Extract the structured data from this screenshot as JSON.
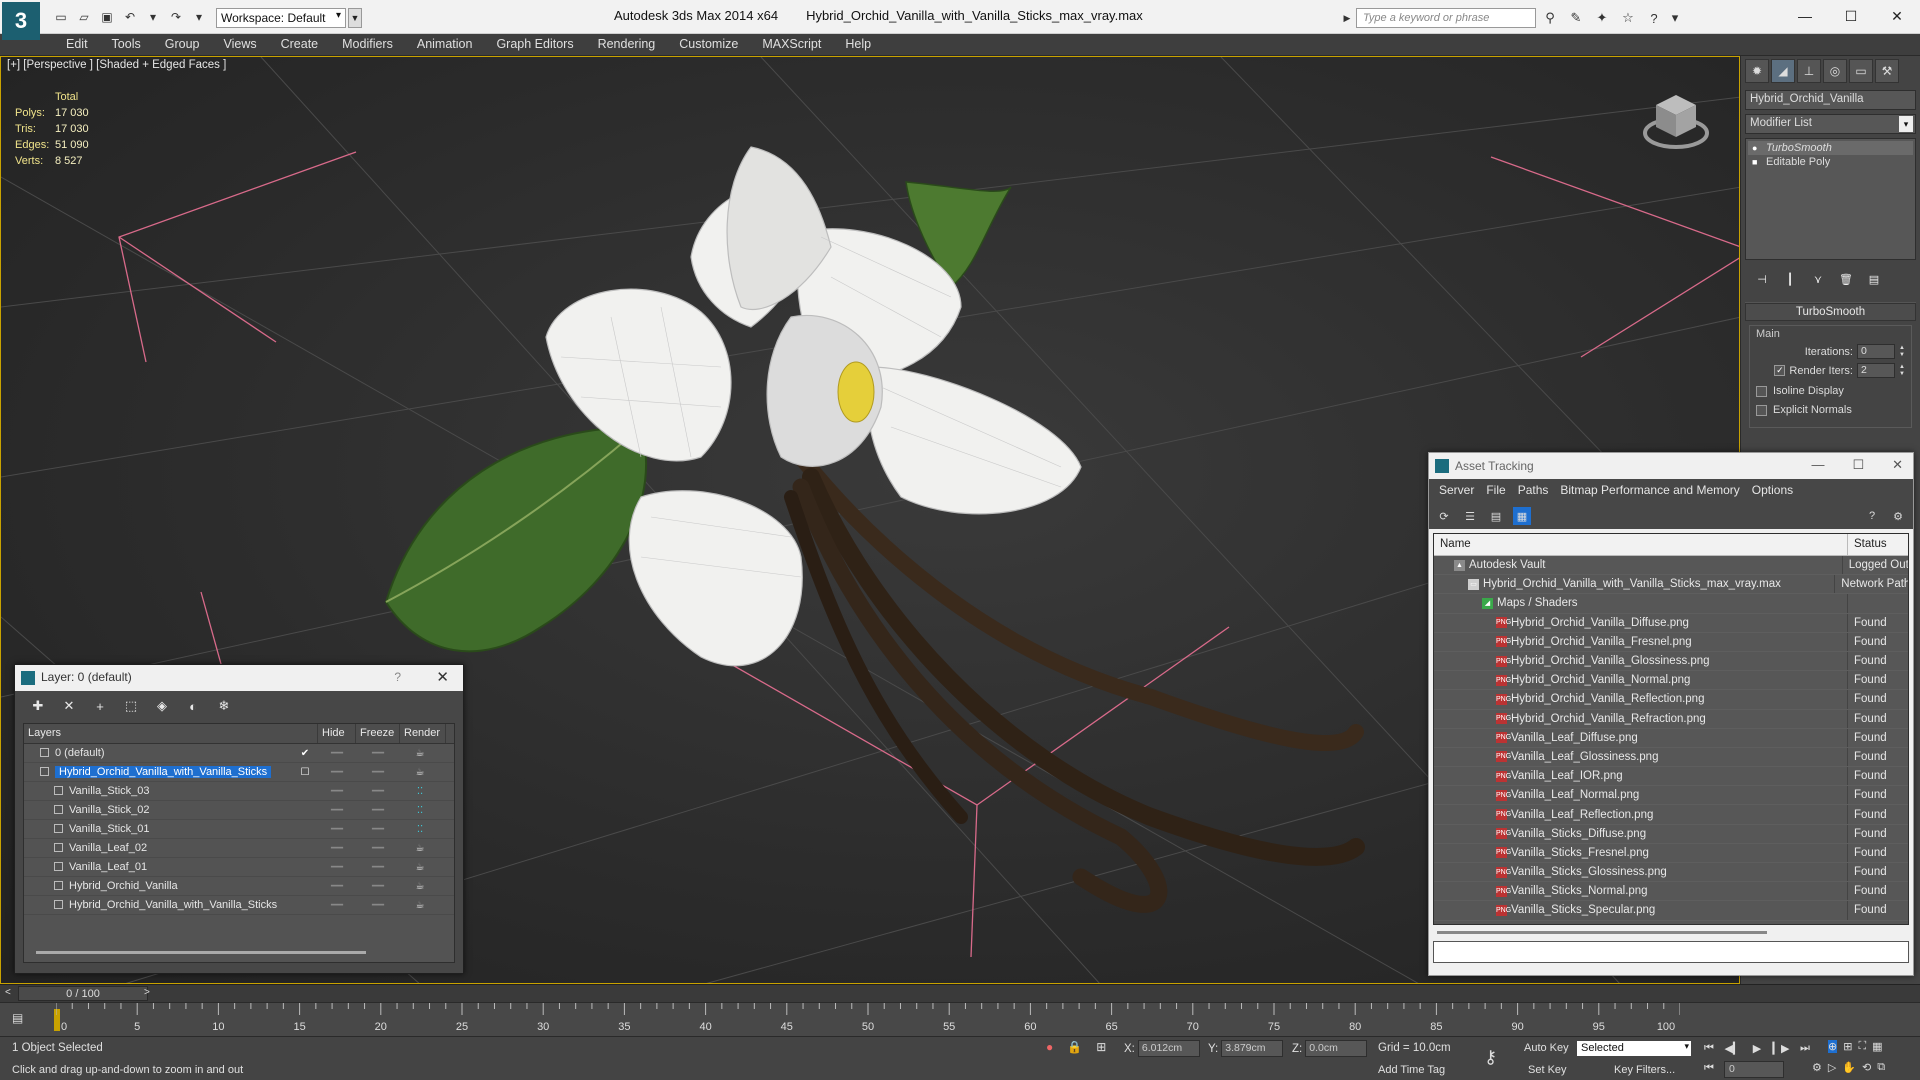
{
  "titlebar": {
    "logo": "3",
    "workspace": "Workspace: Default",
    "app": "Autodesk 3ds Max  2014 x64",
    "file": "Hybrid_Orchid_Vanilla_with_Vanilla_Sticks_max_vray.max",
    "search_placeholder": "Type a keyword or phrase"
  },
  "menu": [
    "Edit",
    "Tools",
    "Group",
    "Views",
    "Create",
    "Modifiers",
    "Animation",
    "Graph Editors",
    "Rendering",
    "Customize",
    "MAXScript",
    "Help"
  ],
  "viewport": {
    "label": "[+] [Perspective ] [Shaded + Edged Faces ]",
    "stats_header": "Total",
    "stats": [
      {
        "k": "Polys:",
        "v": "17 030"
      },
      {
        "k": "Tris:",
        "v": "17 030"
      },
      {
        "k": "Edges:",
        "v": "51 090"
      },
      {
        "k": "Verts:",
        "v": "8 527"
      }
    ]
  },
  "command_panel": {
    "object_name": "Hybrid_Orchid_Vanilla",
    "modifier_list": "Modifier List",
    "stack": [
      "TurboSmooth",
      "Editable Poly"
    ],
    "rollout_title": "TurboSmooth",
    "group_main": "Main",
    "iterations_label": "Iterations:",
    "iterations_value": "0",
    "render_iters_label": "Render Iters:",
    "render_iters_value": "2",
    "isoline_label": "Isoline Display",
    "explicit_label": "Explicit Normals"
  },
  "layer_dialog": {
    "title": "Layer: 0 (default)",
    "help": "?",
    "columns": {
      "layers": "Layers",
      "hide": "Hide",
      "freeze": "Freeze",
      "render": "Render"
    },
    "rows": [
      {
        "name": "0 (default)",
        "indent": 1,
        "active": true,
        "render": "teapot"
      },
      {
        "name": "Hybrid_Orchid_Vanilla_with_Vanilla_Sticks",
        "indent": 1,
        "selected": true,
        "render": "teapot"
      },
      {
        "name": "Vanilla_Stick_03",
        "indent": 2,
        "render": "dots"
      },
      {
        "name": "Vanilla_Stick_02",
        "indent": 2,
        "render": "dots"
      },
      {
        "name": "Vanilla_Stick_01",
        "indent": 2,
        "render": "dots"
      },
      {
        "name": "Vanilla_Leaf_02",
        "indent": 2,
        "render": "teapot"
      },
      {
        "name": "Vanilla_Leaf_01",
        "indent": 2,
        "render": "teapot"
      },
      {
        "name": "Hybrid_Orchid_Vanilla",
        "indent": 2,
        "render": "teapot"
      },
      {
        "name": "Hybrid_Orchid_Vanilla_with_Vanilla_Sticks",
        "indent": 2,
        "render": "teapot"
      }
    ]
  },
  "asset_dialog": {
    "title": "Asset Tracking",
    "menu": [
      "Server",
      "File",
      "Paths",
      "Bitmap Performance and Memory",
      "Options"
    ],
    "columns": {
      "name": "Name",
      "status": "Status"
    },
    "rows": [
      {
        "name": "Autodesk Vault",
        "status": "Logged Out",
        "indent": 1,
        "icon": "vault"
      },
      {
        "name": "Hybrid_Orchid_Vanilla_with_Vanilla_Sticks_max_vray.max",
        "status": "Network Path",
        "indent": 2,
        "icon": "max"
      },
      {
        "name": "Maps / Shaders",
        "status": "",
        "indent": 3,
        "icon": "map"
      },
      {
        "name": "Hybrid_Orchid_Vanilla_Diffuse.png",
        "status": "Found",
        "indent": 4,
        "icon": "png"
      },
      {
        "name": "Hybrid_Orchid_Vanilla_Fresnel.png",
        "status": "Found",
        "indent": 4,
        "icon": "png"
      },
      {
        "name": "Hybrid_Orchid_Vanilla_Glossiness.png",
        "status": "Found",
        "indent": 4,
        "icon": "png"
      },
      {
        "name": "Hybrid_Orchid_Vanilla_Normal.png",
        "status": "Found",
        "indent": 4,
        "icon": "png"
      },
      {
        "name": "Hybrid_Orchid_Vanilla_Reflection.png",
        "status": "Found",
        "indent": 4,
        "icon": "png"
      },
      {
        "name": "Hybrid_Orchid_Vanilla_Refraction.png",
        "status": "Found",
        "indent": 4,
        "icon": "png"
      },
      {
        "name": "Vanilla_Leaf_Diffuse.png",
        "status": "Found",
        "indent": 4,
        "icon": "png"
      },
      {
        "name": "Vanilla_Leaf_Glossiness.png",
        "status": "Found",
        "indent": 4,
        "icon": "png"
      },
      {
        "name": "Vanilla_Leaf_IOR.png",
        "status": "Found",
        "indent": 4,
        "icon": "png"
      },
      {
        "name": "Vanilla_Leaf_Normal.png",
        "status": "Found",
        "indent": 4,
        "icon": "png"
      },
      {
        "name": "Vanilla_Leaf_Reflection.png",
        "status": "Found",
        "indent": 4,
        "icon": "png"
      },
      {
        "name": "Vanilla_Sticks_Diffuse.png",
        "status": "Found",
        "indent": 4,
        "icon": "png"
      },
      {
        "name": "Vanilla_Sticks_Fresnel.png",
        "status": "Found",
        "indent": 4,
        "icon": "png"
      },
      {
        "name": "Vanilla_Sticks_Glossiness.png",
        "status": "Found",
        "indent": 4,
        "icon": "png"
      },
      {
        "name": "Vanilla_Sticks_Normal.png",
        "status": "Found",
        "indent": 4,
        "icon": "png"
      },
      {
        "name": "Vanilla_Sticks_Specular.png",
        "status": "Found",
        "indent": 4,
        "icon": "png"
      }
    ]
  },
  "timeline": {
    "frame_display": "0 / 100",
    "ticks": [
      "0",
      "5",
      "10",
      "15",
      "20",
      "25",
      "30",
      "35",
      "40",
      "45",
      "50",
      "55",
      "60",
      "65",
      "70",
      "75",
      "80",
      "85",
      "90",
      "95",
      "100"
    ]
  },
  "statusbar": {
    "selection": "1 Object Selected",
    "prompt": "Click and drag up-and-down to zoom in and out",
    "x_label": "X:",
    "x_value": "6.012cm",
    "y_label": "Y:",
    "y_value": "3.879cm",
    "z_label": "Z:",
    "z_value": "0.0cm",
    "grid": "Grid = 10.0cm",
    "add_time_tag": "Add Time Tag",
    "auto_key": "Auto Key",
    "set_key": "Set Key",
    "selected_dd": "Selected",
    "key_filters": "Key Filters...",
    "frame_field": "0"
  }
}
